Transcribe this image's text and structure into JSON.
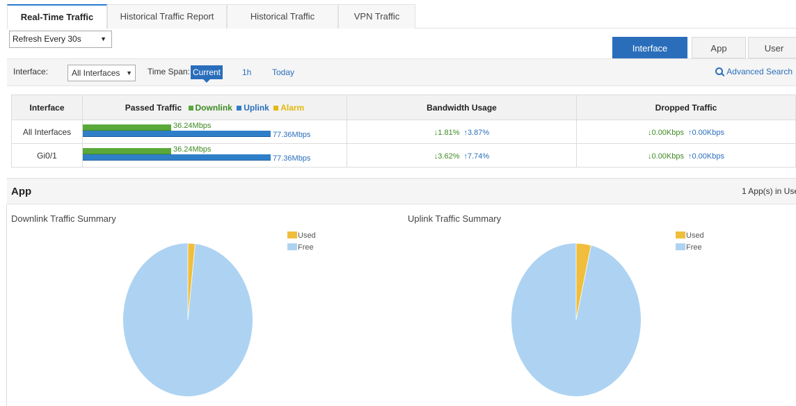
{
  "tabs": [
    {
      "label": "Real-Time Traffic",
      "active": true
    },
    {
      "label": "Historical Traffic Report",
      "active": false
    },
    {
      "label": "Historical Traffic",
      "active": false
    },
    {
      "label": "VPN Traffic",
      "active": false
    }
  ],
  "refresh": {
    "value": "Refresh Every 30s"
  },
  "view_modes": [
    {
      "label": "Interface",
      "active": true
    },
    {
      "label": "App",
      "active": false
    },
    {
      "label": "User",
      "active": false
    }
  ],
  "filter": {
    "interface_label": "Interface:",
    "interface_value": "All Interfaces",
    "timespan_label": "Time Span:",
    "spans": [
      "Current",
      "1h",
      "Today"
    ],
    "active_span": "Current",
    "advanced_search": "Advanced Search"
  },
  "table": {
    "headers": {
      "interface": "Interface",
      "passed": "Passed Traffic",
      "bandwidth": "Bandwidth Usage",
      "dropped": "Dropped Traffic"
    },
    "legend": {
      "downlink": "Downlink",
      "uplink": "Uplink",
      "alarm": "Alarm"
    },
    "rows": [
      {
        "interface": "All Interfaces",
        "down": "36.24Mbps",
        "up": "77.36Mbps",
        "down_frac": 0.47,
        "up_frac": 1.0,
        "usage_down": "↓1.81%",
        "usage_up": "↑3.87%",
        "drop_down": "↓0.00Kbps",
        "drop_up": "↑0.00Kbps"
      },
      {
        "interface": "Gi0/1",
        "down": "36.24Mbps",
        "up": "77.36Mbps",
        "down_frac": 0.47,
        "up_frac": 1.0,
        "usage_down": "↓3.62%",
        "usage_up": "↑7.74%",
        "drop_down": "↓0.00Kbps",
        "drop_up": "↑0.00Kbps"
      }
    ]
  },
  "colors": {
    "downlink": "#5aa83a",
    "uplink": "#2f7fc8",
    "alarm": "#e5b80b",
    "used": "#f0be3c",
    "free": "#aed3f2",
    "accent": "#2a6ebb"
  },
  "app": {
    "title": "App",
    "count": "1 App(s) in Use",
    "legend_used": "Used",
    "legend_free": "Free",
    "charts": [
      {
        "title": "Downlink Traffic Summary",
        "used_fraction": 0.018
      },
      {
        "title": "Uplink Traffic Summary",
        "used_fraction": 0.037
      }
    ]
  },
  "chart_data": [
    {
      "type": "pie",
      "title": "Downlink Traffic Summary",
      "labels": [
        "Used",
        "Free"
      ],
      "values": [
        1.81,
        98.19
      ],
      "legend_position": "top-right"
    },
    {
      "type": "pie",
      "title": "Uplink Traffic Summary",
      "labels": [
        "Used",
        "Free"
      ],
      "values": [
        3.87,
        96.13
      ],
      "legend_position": "top-right"
    }
  ]
}
